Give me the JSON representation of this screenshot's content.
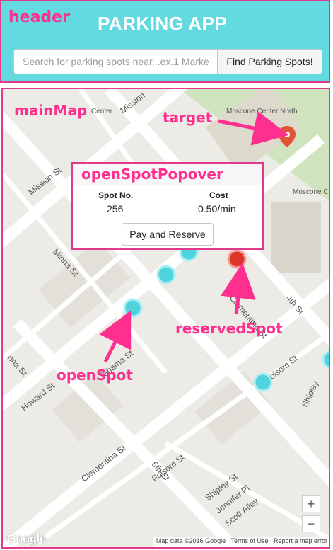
{
  "header": {
    "tag_label": "header",
    "title": "PARKING APP",
    "search_placeholder": "Search for parking spots near...ex.1 Marke",
    "find_button": "Find Parking Spots!"
  },
  "map": {
    "tag_label": "mainMap",
    "target_tag": "target",
    "reserved_tag": "reservedSpot",
    "open_tag": "openSpot",
    "streets": {
      "mission_st": "Mission St",
      "mission_top": "Mission",
      "minna_st": "Minna St",
      "howard_st": "Howard St",
      "tehama_st": "Tehama St",
      "clementina_st_right": "Clementina St",
      "fourth_st": "4th St",
      "folsom_st_right": "Folsom St",
      "folsom_st_center": "Folsom St",
      "clementina_st_left": "Clementina St",
      "fifth_st": "5th St",
      "shipley_st": "Shipley St",
      "jennifer_pl": "Jennifer Pl",
      "scott_alley": "Scott Alley",
      "shipley_right": "Shipley",
      "natoma_st": "nna St",
      "moscone_center_north": "Moscone Center North",
      "moscone_c": "Moscone C",
      "center": "Center"
    },
    "footer": {
      "google": "Google",
      "data": "Map data ©2016 Google",
      "terms": "Terms of Use",
      "report": "Report a map error"
    },
    "zoom_in": "+",
    "zoom_out": "−"
  },
  "popover": {
    "tag_label": "openSpotPopover",
    "spot_label": "Spot No.",
    "spot_value": "256",
    "cost_label": "Cost",
    "cost_value": "0.50/min",
    "pay_button": "Pay and Reserve"
  },
  "colors": {
    "header_bg": "#62dadf",
    "annotation": "#ff2f8f",
    "open_spot": "#4fd3df",
    "reserved_spot": "#e0352b",
    "target_pin": "#e45336"
  }
}
